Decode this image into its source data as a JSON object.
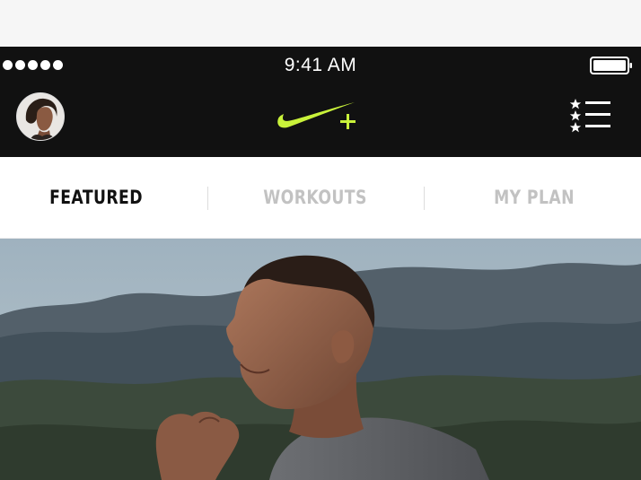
{
  "status_bar": {
    "time": "9:41 AM",
    "signal_dots": 5,
    "icons": [
      "signal-dots-icon",
      "battery-icon"
    ]
  },
  "nav_bar": {
    "avatar_icon": "user-avatar",
    "logo_icon": "nike-plus-logo",
    "menu_icon": "starred-list-menu-icon",
    "logo_color": "#c9f23a"
  },
  "tabs": [
    {
      "label": "FEATURED",
      "active": true
    },
    {
      "label": "WORKOUTS",
      "active": false
    },
    {
      "label": "MY PLAN",
      "active": false
    }
  ],
  "colors": {
    "bar_bg": "#111111",
    "accent": "#c9f23a",
    "tab_active": "#111111",
    "tab_inactive": "#c2c2c2"
  },
  "hero": {
    "image": "athlete-running-outdoors"
  }
}
